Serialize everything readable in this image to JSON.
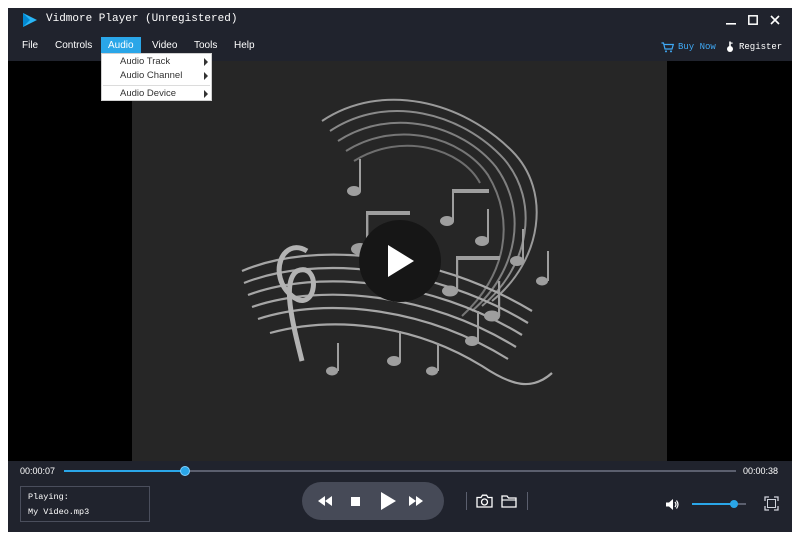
{
  "window": {
    "title": "Vidmore Player (Unregistered)",
    "controls": [
      "minimize",
      "maximize",
      "close"
    ]
  },
  "menu": {
    "items": [
      {
        "label": "File"
      },
      {
        "label": "Controls"
      },
      {
        "label": "Audio",
        "active": true
      },
      {
        "label": "Video"
      },
      {
        "label": "Tools"
      },
      {
        "label": "Help"
      }
    ],
    "buy_now": "Buy Now",
    "register": "Register"
  },
  "audio_menu": {
    "items": [
      {
        "label": "Audio Track",
        "has_submenu": true
      },
      {
        "label": "Audio Channel",
        "has_submenu": true
      },
      {
        "label": "Audio Device",
        "has_submenu": true
      }
    ]
  },
  "playback": {
    "current_time": "00:00:07",
    "total_time": "00:00:38",
    "progress_fraction": 0.18,
    "volume_fraction": 0.78
  },
  "status": {
    "label": "Playing:",
    "file": "My Video.mp3"
  },
  "icons": {
    "logo": "vidmore-play-logo-icon",
    "buy": "cart-icon",
    "register": "key-icon",
    "rewind": "rewind-icon",
    "stop": "stop-icon",
    "play": "play-icon",
    "forward": "fast-forward-icon",
    "snapshot": "camera-icon",
    "open": "folder-icon",
    "volume": "speaker-icon",
    "fullscreen": "fullscreen-icon"
  },
  "colors": {
    "background": "#20232d",
    "accent": "#2aa6e8",
    "buy_now": "#3fa9f5",
    "artwork_bg": "#262626"
  }
}
